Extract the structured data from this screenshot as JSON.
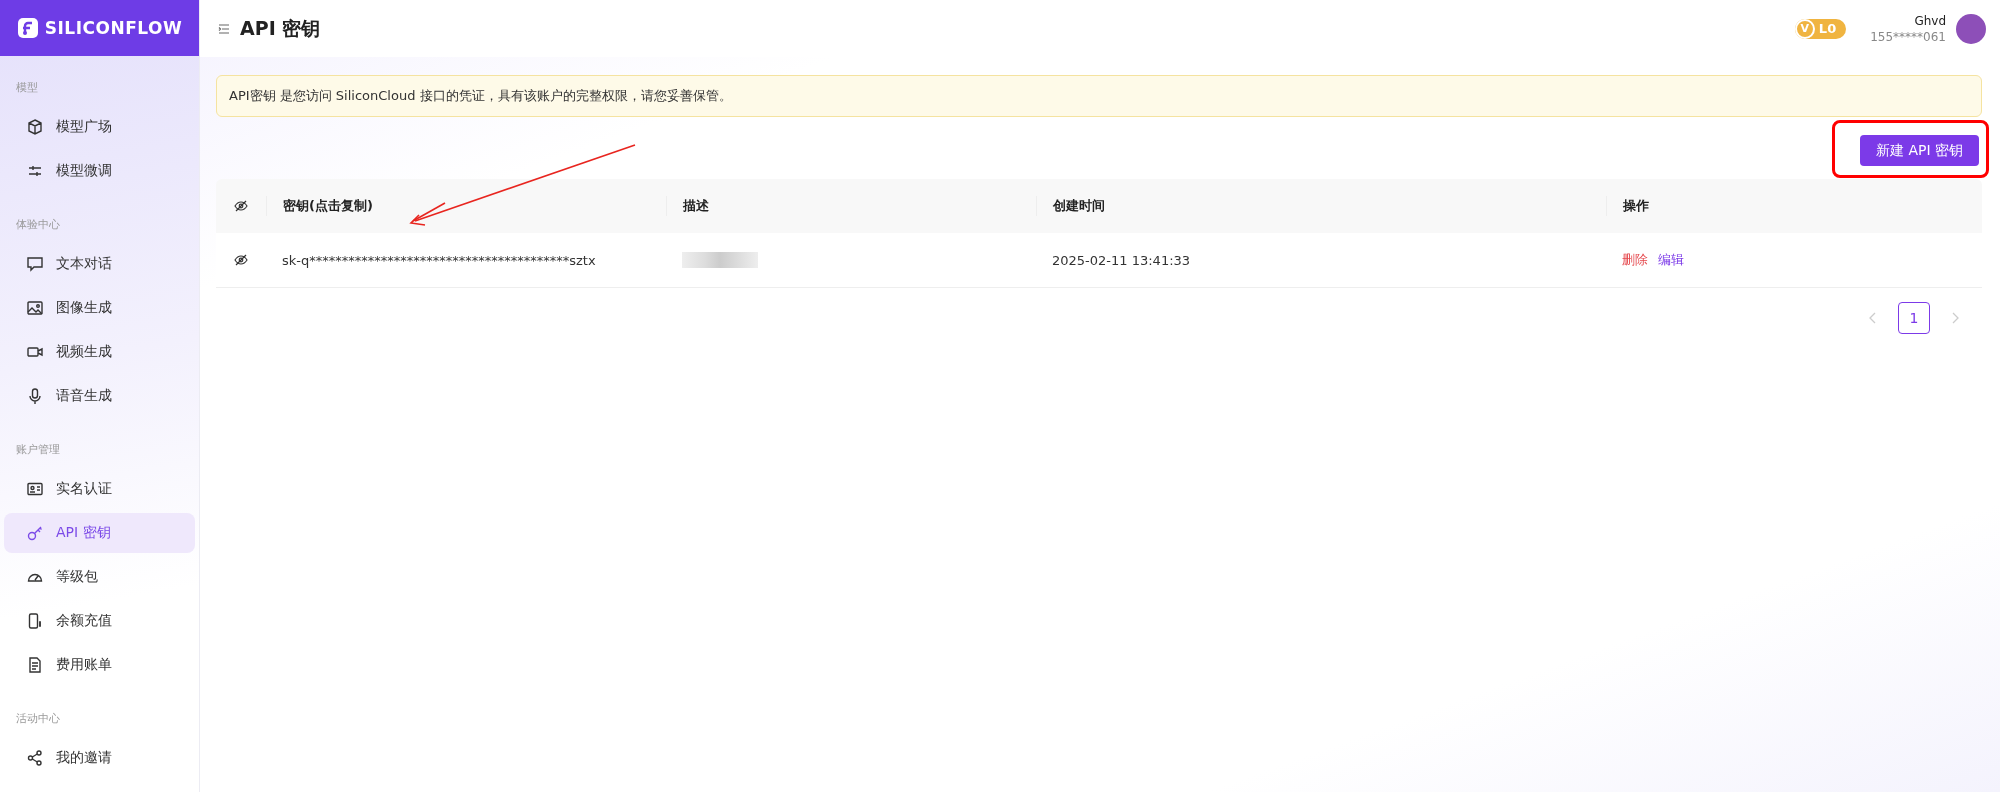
{
  "sidebar": {
    "logo": "SILICONFLOW",
    "sections": [
      {
        "label": "模型",
        "items": [
          {
            "label": "模型广场",
            "selected": false
          },
          {
            "label": "模型微调",
            "selected": false
          }
        ]
      },
      {
        "label": "体验中心",
        "items": [
          {
            "label": "文本对话",
            "selected": false
          },
          {
            "label": "图像生成",
            "selected": false
          },
          {
            "label": "视频生成",
            "selected": false
          },
          {
            "label": "语音生成",
            "selected": false
          }
        ]
      },
      {
        "label": "账户管理",
        "items": [
          {
            "label": "实名认证",
            "selected": false
          },
          {
            "label": "API 密钥",
            "selected": true
          },
          {
            "label": "等级包",
            "selected": false
          },
          {
            "label": "余额充值",
            "selected": false
          },
          {
            "label": "费用账单",
            "selected": false
          }
        ]
      },
      {
        "label": "活动中心",
        "items": [
          {
            "label": "我的邀请",
            "selected": false
          }
        ]
      }
    ]
  },
  "header": {
    "title": "API 密钥",
    "badge_letter": "V",
    "level": "L0",
    "user_name": "Ghvd",
    "user_phone": "155*****061"
  },
  "notice": "API密钥 是您访问 SiliconCloud 接口的凭证，具有该账户的完整权限，请您妥善保管。",
  "new_button": "新建 API 密钥",
  "table": {
    "columns": [
      "密钥(点击复制)",
      "描述",
      "创建时间",
      "操作"
    ],
    "rows": [
      {
        "key": "sk-q****************************************sztx",
        "created": "2025-02-11 13:41:33",
        "actions": [
          {
            "label": "删除",
            "kind": "danger"
          },
          {
            "label": "编辑",
            "kind": "link"
          }
        ]
      }
    ]
  },
  "pagination": {
    "prev_disabled": true,
    "next_disabled": true,
    "pages": [
      {
        "label": "1",
        "selected": true
      }
    ]
  }
}
